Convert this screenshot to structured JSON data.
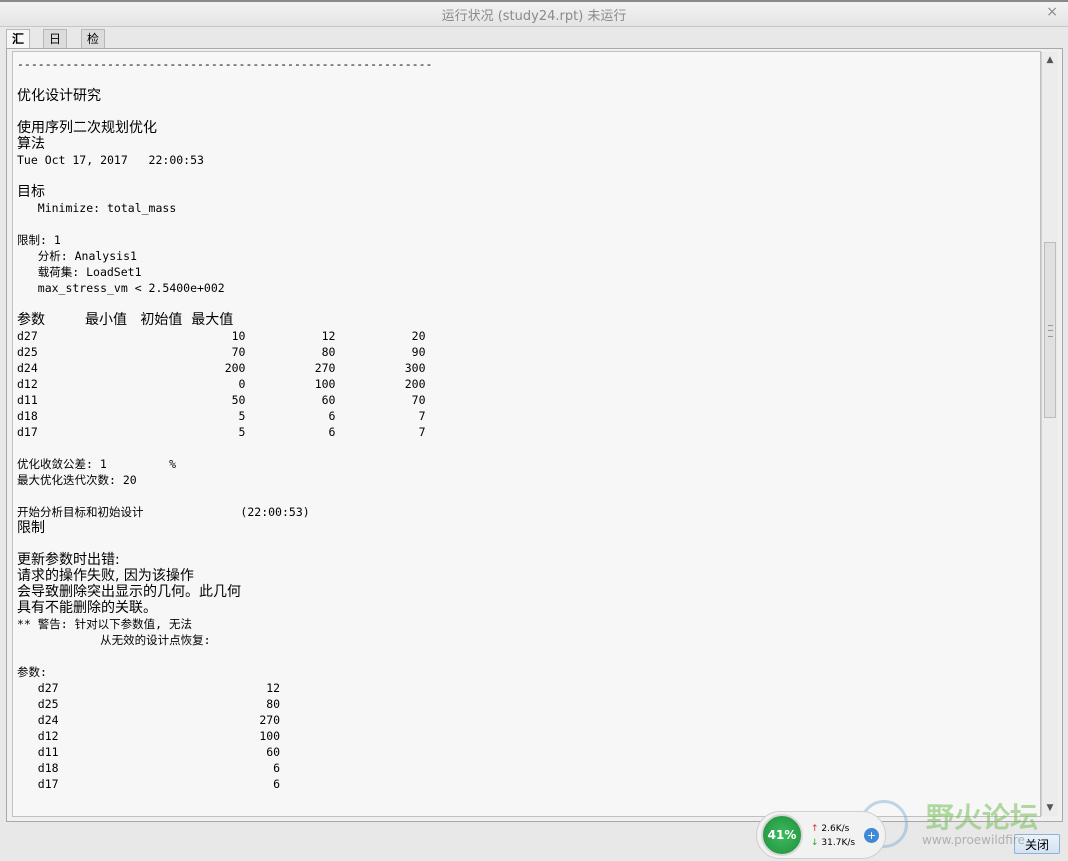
{
  "window": {
    "title": "运行状况 (study24.rpt) 未运行",
    "close_glyph": "×"
  },
  "tabs": [
    {
      "label": "汇总",
      "active": true
    },
    {
      "label": "日志",
      "active": false
    },
    {
      "label": "检查点",
      "active": false
    }
  ],
  "report_lines": [
    {
      "text": "------------------------------------------------------------",
      "big": false
    },
    {
      "text": "",
      "big": false
    },
    {
      "text": "优化设计研究",
      "big": true
    },
    {
      "text": "",
      "big": false
    },
    {
      "text": "使用序列二次规划优化",
      "big": true
    },
    {
      "text": "算法",
      "big": true
    },
    {
      "text": "Tue Oct 17, 2017   22:00:53",
      "big": false
    },
    {
      "text": "",
      "big": false
    },
    {
      "text": "目标",
      "big": true
    },
    {
      "text": "   Minimize: total_mass",
      "big": false
    },
    {
      "text": "",
      "big": false
    },
    {
      "text": "限制: 1",
      "big": false
    },
    {
      "text": "   分析: Analysis1",
      "big": false
    },
    {
      "text": "   载荷集: LoadSet1",
      "big": false
    },
    {
      "text": "   max_stress_vm < 2.5400e+002",
      "big": false
    },
    {
      "text": "",
      "big": false
    },
    {
      "text": "参数         最小值   初始值  最大值",
      "big": true
    },
    {
      "text": "d27                            10           12           20",
      "big": false
    },
    {
      "text": "d25                            70           80           90",
      "big": false
    },
    {
      "text": "d24                           200          270          300",
      "big": false
    },
    {
      "text": "d12                             0          100          200",
      "big": false
    },
    {
      "text": "d11                            50           60           70",
      "big": false
    },
    {
      "text": "d18                             5            6            7",
      "big": false
    },
    {
      "text": "d17                             5            6            7",
      "big": false
    },
    {
      "text": "",
      "big": false
    },
    {
      "text": "优化收敛公差: 1         %",
      "big": false
    },
    {
      "text": "最大优化迭代次数: 20",
      "big": false
    },
    {
      "text": "",
      "big": false
    },
    {
      "text": "开始分析目标和初始设计              (22:00:53)",
      "big": false
    },
    {
      "text": "限制",
      "big": true
    },
    {
      "text": "",
      "big": false
    },
    {
      "text": "更新参数时出错:",
      "big": true
    },
    {
      "text": "请求的操作失败, 因为该操作",
      "big": true
    },
    {
      "text": "会导致删除突出显示的几何。此几何",
      "big": true
    },
    {
      "text": "具有不能删除的关联。",
      "big": true
    },
    {
      "text": "** 警告: 针对以下参数值, 无法",
      "big": false
    },
    {
      "text": "            从无效的设计点恢复:",
      "big": false
    },
    {
      "text": "",
      "big": false
    },
    {
      "text": "参数:",
      "big": false
    },
    {
      "text": "   d27                              12",
      "big": false
    },
    {
      "text": "   d25                              80",
      "big": false
    },
    {
      "text": "   d24                             270",
      "big": false
    },
    {
      "text": "   d12                             100",
      "big": false
    },
    {
      "text": "   d11                              60",
      "big": false
    },
    {
      "text": "   d18                               6",
      "big": false
    },
    {
      "text": "   d17                               6",
      "big": false
    }
  ],
  "footer": {
    "close_label": "关闭"
  },
  "net_meter": {
    "percent": "41%",
    "upload": "2.6K/s",
    "download": "31.7K/s",
    "up_arrow": "↑",
    "down_arrow": "↓",
    "plus": "+"
  },
  "watermark": {
    "text": "野火论坛",
    "url": "www.proewildfire"
  }
}
